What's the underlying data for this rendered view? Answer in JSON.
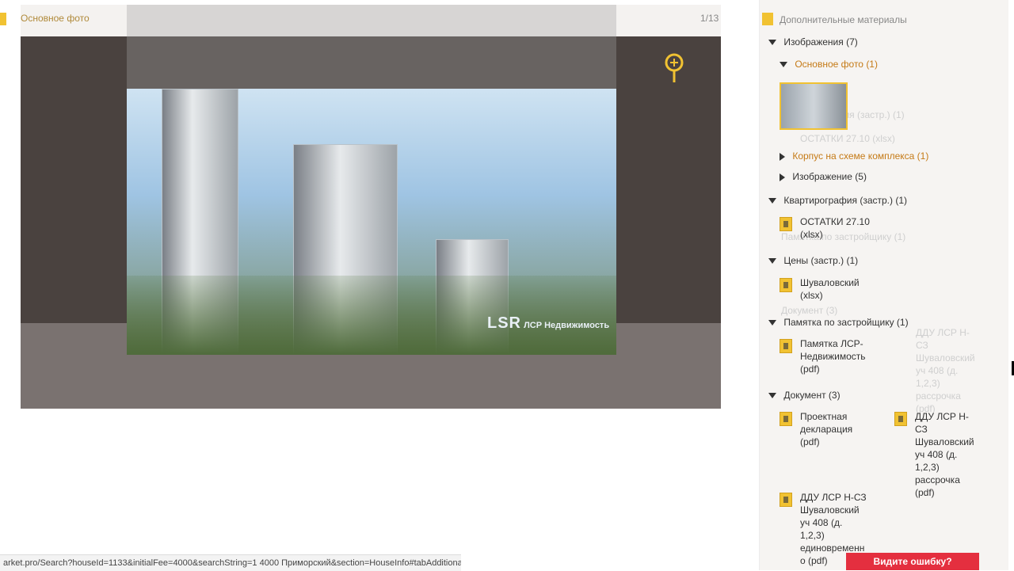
{
  "viewer": {
    "title": "Основное фото",
    "counter": "1/13",
    "watermark_logo": "LSR",
    "watermark_text": "ЛСР Недвижимость"
  },
  "panel": {
    "title": "Дополнительные материалы",
    "groups": [
      {
        "label": "Изображения (7)"
      },
      {
        "label": "Основное фото (1)"
      },
      {
        "label": "Корпус на схеме комплекса (1)"
      },
      {
        "label": "Изображение (5)"
      },
      {
        "label": "Квартирография (застр.) (1)"
      },
      {
        "label": "Цены (застр.) (1)"
      },
      {
        "label": "Памятка по застройщику (1)"
      },
      {
        "label": "Документ (3)"
      }
    ],
    "files": [
      {
        "label": "ОСТАТКИ 27.10 (xlsx)"
      },
      {
        "label": "Шуваловский (xlsx)"
      },
      {
        "label": "Памятка ЛСР-Недвижимость (pdf)"
      },
      {
        "label": "Проектная декларация (pdf)"
      },
      {
        "label": "ДДУ ЛСР Н-СЗ Шуваловский уч 408 (д. 1,2,3) рассрочка (pdf)"
      },
      {
        "label": "ДДУ ЛСР Н-СЗ Шуваловский уч 408 (д. 1,2,3) единовременн о (pdf)"
      }
    ],
    "ghost_texts": [
      "ОСТАТКИ 27.10 (xlsx)",
      "Квартирография (застр.) (1)",
      "Памятка по застройщику (1)",
      "Документ (3)",
      "ДДУ ЛСР Н-СЗ Шуваловский уч 408 (д. 1,2,3) рассрочка (pdf)"
    ]
  },
  "status_bar": {
    "url": "arket.pro/Search?houseId=1133&initialFee=4000&searchString=1 4000 Приморский&section=HouseInfo#tabAdditional"
  },
  "error_button": {
    "label": "Видите ошибку?"
  }
}
